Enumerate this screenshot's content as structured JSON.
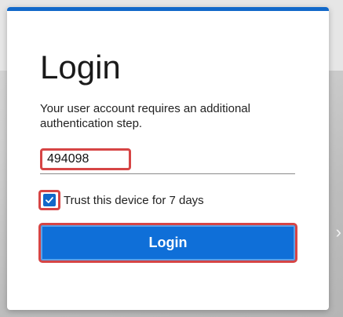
{
  "login": {
    "title": "Login",
    "description": "Your user account requires an additional authentication step.",
    "code_value": "494098",
    "trust_label": "Trust this device for 7 days",
    "trust_checked": true,
    "button_label": "Login"
  },
  "colors": {
    "accent": "#1168c9",
    "button": "#0f6fd8",
    "highlight": "#d64545"
  },
  "icons": {
    "checkbox": "checkmark-icon",
    "background_glyph": "chevron-right-icon"
  }
}
